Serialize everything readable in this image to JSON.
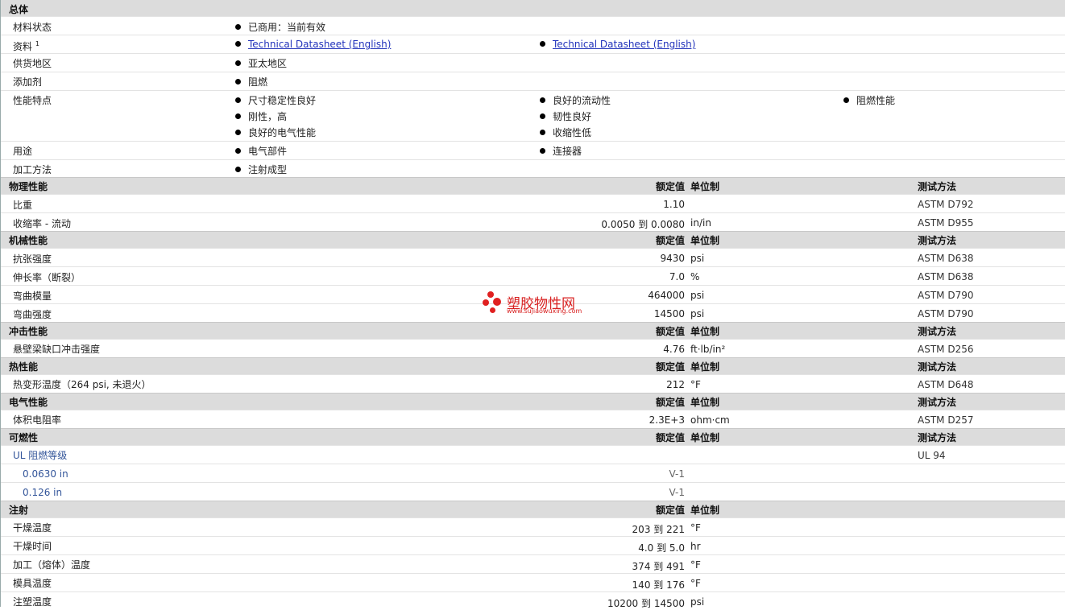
{
  "general": {
    "title": "总体",
    "status": {
      "label": "材料状态",
      "value": "已商用：当前有效"
    },
    "docs": {
      "label": "资料",
      "sup": "1",
      "links": [
        "Technical Datasheet (English)",
        "Technical Datasheet (English)"
      ]
    },
    "region": {
      "label": "供货地区",
      "value": "亚太地区"
    },
    "additive": {
      "label": "添加剂",
      "value": "阻燃"
    },
    "features": {
      "label": "性能特点",
      "col1": [
        "尺寸稳定性良好",
        "刚性，高",
        "良好的电气性能"
      ],
      "col2": [
        "良好的流动性",
        "韧性良好",
        "收缩性低"
      ],
      "col3": [
        "阻燃性能"
      ]
    },
    "uses": {
      "label": "用途",
      "col1": "电气部件",
      "col2": "连接器"
    },
    "processing": {
      "label": "加工方法",
      "value": "注射成型"
    }
  },
  "headers": {
    "value": "额定值",
    "unit": "单位制",
    "test": "测试方法"
  },
  "physical": {
    "title": "物理性能",
    "rows": [
      {
        "label": "比重",
        "value": "1.10",
        "unit": "",
        "test": "ASTM D792"
      },
      {
        "label": "收缩率 - 流动",
        "value": "0.0050 到  0.0080",
        "unit": "in/in",
        "test": "ASTM D955"
      }
    ]
  },
  "mechanical": {
    "title": "机械性能",
    "rows": [
      {
        "label": "抗张强度",
        "value": "9430",
        "unit": "psi",
        "test": "ASTM D638"
      },
      {
        "label": "伸长率（断裂）",
        "value": "7.0",
        "unit": "%",
        "test": "ASTM D638"
      },
      {
        "label": "弯曲模量",
        "value": "464000",
        "unit": "psi",
        "test": "ASTM D790"
      },
      {
        "label": "弯曲强度",
        "value": "14500",
        "unit": "psi",
        "test": "ASTM D790"
      }
    ]
  },
  "impact": {
    "title": "冲击性能",
    "rows": [
      {
        "label": "悬壁梁缺口冲击强度",
        "value": "4.76",
        "unit": "ft·lb/in²",
        "test": "ASTM D256"
      }
    ]
  },
  "thermal": {
    "title": "热性能",
    "rows": [
      {
        "label": "热变形温度（264 psi, 未退火）",
        "value": "212",
        "unit": "°F",
        "test": "ASTM D648"
      }
    ]
  },
  "electrical": {
    "title": "电气性能",
    "rows": [
      {
        "label": "体积电阻率",
        "value": "2.3E+3",
        "unit": "ohm·cm",
        "test": "ASTM D257"
      }
    ]
  },
  "flammability": {
    "title": "可燃性",
    "ul": {
      "label": "UL 阻燃等级",
      "test": "UL 94"
    },
    "rows": [
      {
        "label": "0.0630 in",
        "value": "V-1"
      },
      {
        "label": "0.126 in",
        "value": "V-1"
      }
    ]
  },
  "injection": {
    "title": "注射",
    "rows": [
      {
        "label": "干燥温度",
        "value": "203 到  221",
        "unit": "°F"
      },
      {
        "label": "干燥时间",
        "value": "4.0 到  5.0",
        "unit": "hr"
      },
      {
        "label": "加工（熔体）温度",
        "value": "374 到  491",
        "unit": "°F"
      },
      {
        "label": "模具温度",
        "value": "140 到  176",
        "unit": "°F"
      },
      {
        "label": "注塑温度",
        "value": "10200 到  14500",
        "unit": "psi"
      }
    ]
  },
  "watermark": {
    "text": "塑胶物性网",
    "url": "www.sujiaowuxing.com"
  },
  "colors": {
    "section_bg": "#dcdcdc",
    "link": "#2233bb",
    "watermark": "#d82020"
  }
}
